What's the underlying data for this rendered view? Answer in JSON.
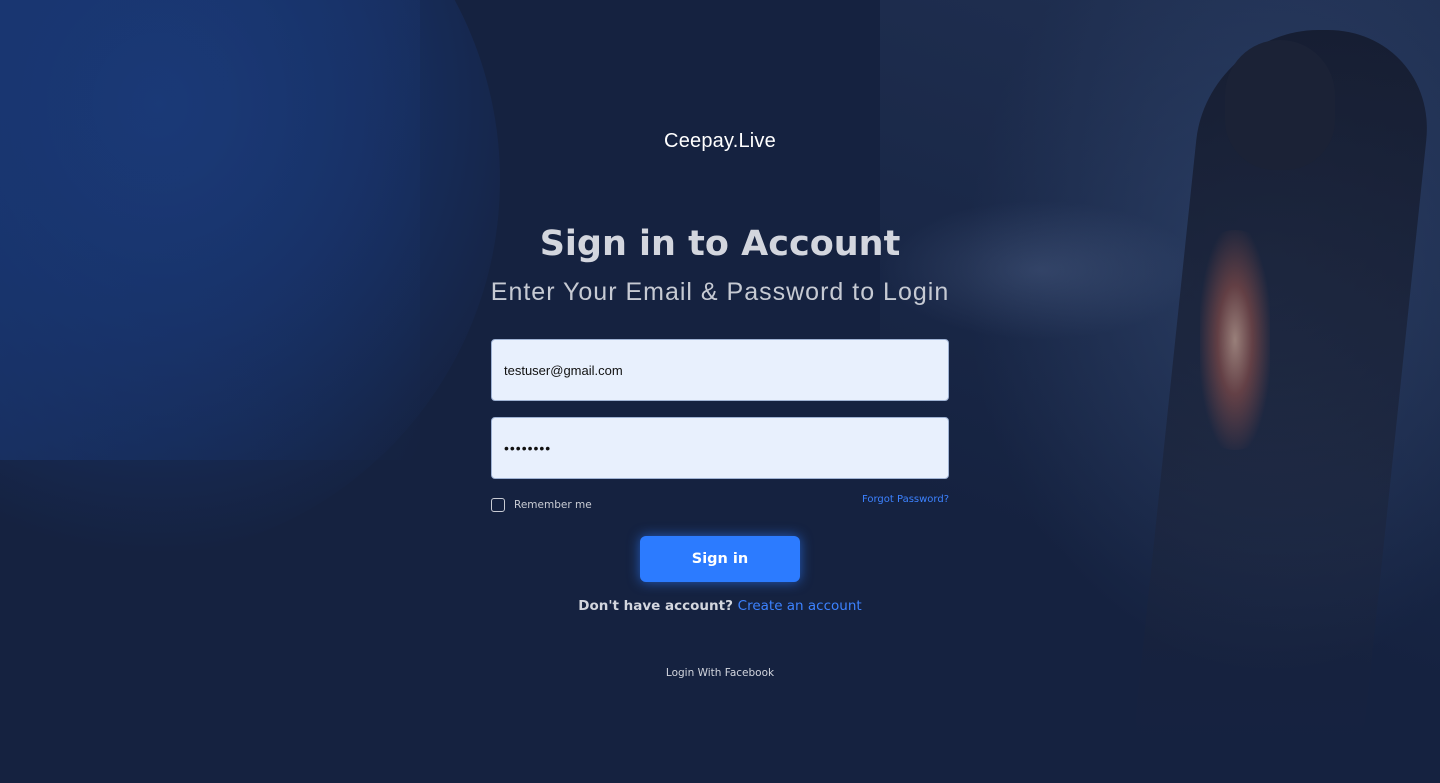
{
  "brand": {
    "logo_text": "Ceepay.Live"
  },
  "login": {
    "title": "Sign in to Account",
    "subtitle": "Enter Your Email & Password to Login",
    "email_value": "testuser@gmail.com",
    "password_value": "12345678",
    "remember_label": "Remember me",
    "remember_checked": false,
    "forgot_label": "Forgot Password?",
    "submit_label": "Sign in",
    "no_account_text": "Don't have account?",
    "create_account_label": "Create an account",
    "facebook_label": "Login With Facebook"
  },
  "colors": {
    "background": "#152240",
    "accent": "#2c7bff",
    "link": "#3c82ff",
    "input_bg": "#e8f0fd"
  }
}
